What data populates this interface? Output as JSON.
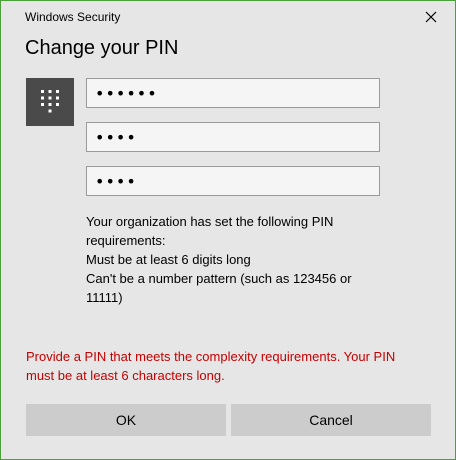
{
  "window": {
    "title": "Windows Security",
    "close_icon": "close-icon"
  },
  "dialog": {
    "heading": "Change your PIN",
    "keypad_icon": "keypad-icon"
  },
  "fields": [
    {
      "name": "current-pin",
      "value": "••••••"
    },
    {
      "name": "new-pin",
      "value": "••••"
    },
    {
      "name": "confirm-pin",
      "value": "••••"
    }
  ],
  "requirements": {
    "intro_line1": "Your organization has set the following PIN",
    "intro_line2": "requirements:",
    "rule1": "Must be at least 6 digits long",
    "rule2_line1": "Can't be a number pattern (such as 123456 or",
    "rule2_line2": "11111)"
  },
  "error": {
    "line1": "Provide a PIN that meets the complexity requirements. Your PIN",
    "line2": "must be at least 6 characters long."
  },
  "buttons": {
    "ok": "OK",
    "cancel": "Cancel"
  },
  "colors": {
    "window_border": "#4aa13a",
    "background": "#e6e6e6",
    "error_text": "#c40000",
    "button_bg": "#cccccc",
    "keypad_tile": "#4a4a4a"
  }
}
